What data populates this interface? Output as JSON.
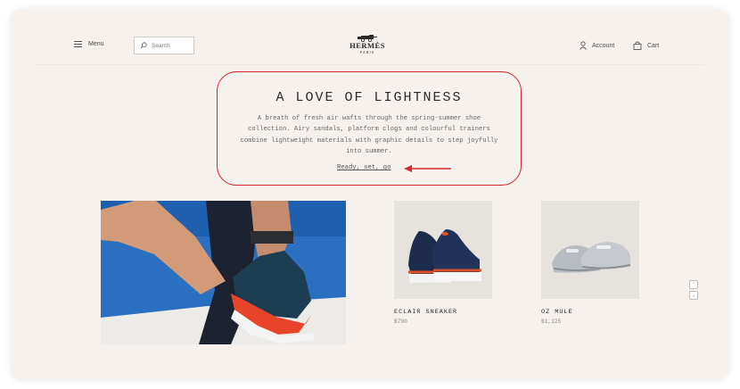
{
  "header": {
    "menu_label": "Menu",
    "search_placeholder": "Search",
    "logo_brand": "HERMÈS",
    "logo_city": "PARIS",
    "account_label": "Account",
    "cart_label": "Cart"
  },
  "hero": {
    "title": "A LOVE OF LIGHTNESS",
    "body": "A breath of fresh air wafts through the spring-summer shoe collection. Airy sandals, platform clogs and colourful trainers combine lightweight materials with graphic details to step joyfully into summer.",
    "link": "Ready, set, go"
  },
  "products": [
    {
      "name": "ECLAIR SNEAKER",
      "price": "$790"
    },
    {
      "name": "OZ MULE",
      "price": "$1,125"
    }
  ],
  "colors": {
    "background": "#f6f1ec",
    "annotation_red": "#d7262c"
  }
}
